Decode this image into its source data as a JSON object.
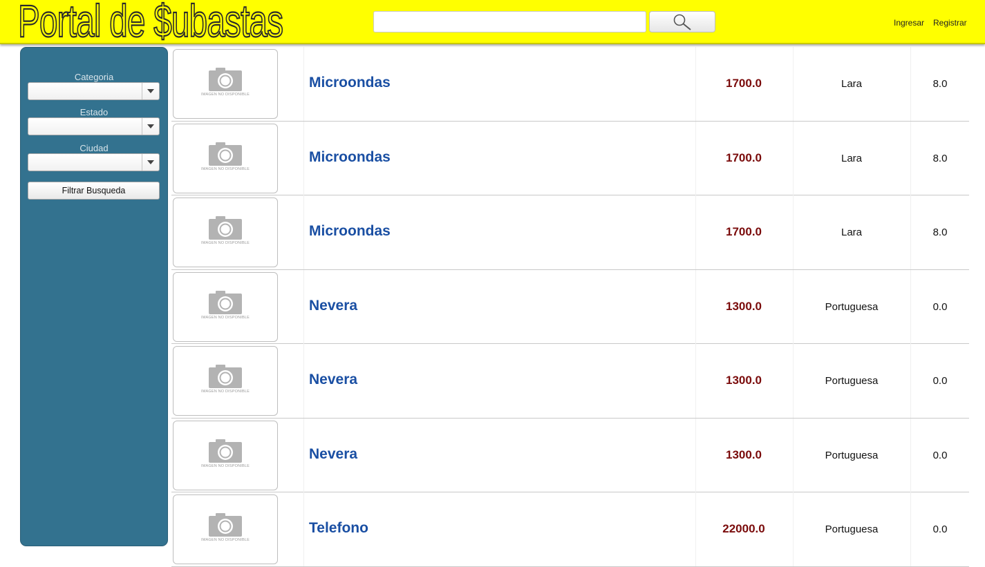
{
  "header": {
    "logo_text": "Portal de $ubastas",
    "search": {
      "value": "",
      "placeholder": ""
    },
    "search_icon": "magnifier-icon",
    "login_label": "Ingresar",
    "register_label": "Registrar"
  },
  "sidebar": {
    "category_label": "Categoria",
    "category_value": "",
    "state_label": "Estado",
    "state_value": "",
    "city_label": "Ciudad",
    "city_value": "",
    "filter_button_label": "Filtrar Busqueda"
  },
  "listing": {
    "no_image_text": "IMAGEN NO DISPONIBLE",
    "rows": [
      {
        "name": "Microondas",
        "price": "1700.0",
        "state": "Lara",
        "rating": "8.0"
      },
      {
        "name": "Microondas",
        "price": "1700.0",
        "state": "Lara",
        "rating": "8.0"
      },
      {
        "name": "Microondas",
        "price": "1700.0",
        "state": "Lara",
        "rating": "8.0"
      },
      {
        "name": "Nevera",
        "price": "1300.0",
        "state": "Portuguesa",
        "rating": "0.0"
      },
      {
        "name": "Nevera",
        "price": "1300.0",
        "state": "Portuguesa",
        "rating": "0.0"
      },
      {
        "name": "Nevera",
        "price": "1300.0",
        "state": "Portuguesa",
        "rating": "0.0"
      },
      {
        "name": "Telefono",
        "price": "22000.0",
        "state": "Portuguesa",
        "rating": "0.0"
      }
    ]
  },
  "colors": {
    "header_bg": "#ffff00",
    "sidebar_bg": "#33728f",
    "product_name": "#1a4fa3",
    "price": "#7a0b0b"
  }
}
